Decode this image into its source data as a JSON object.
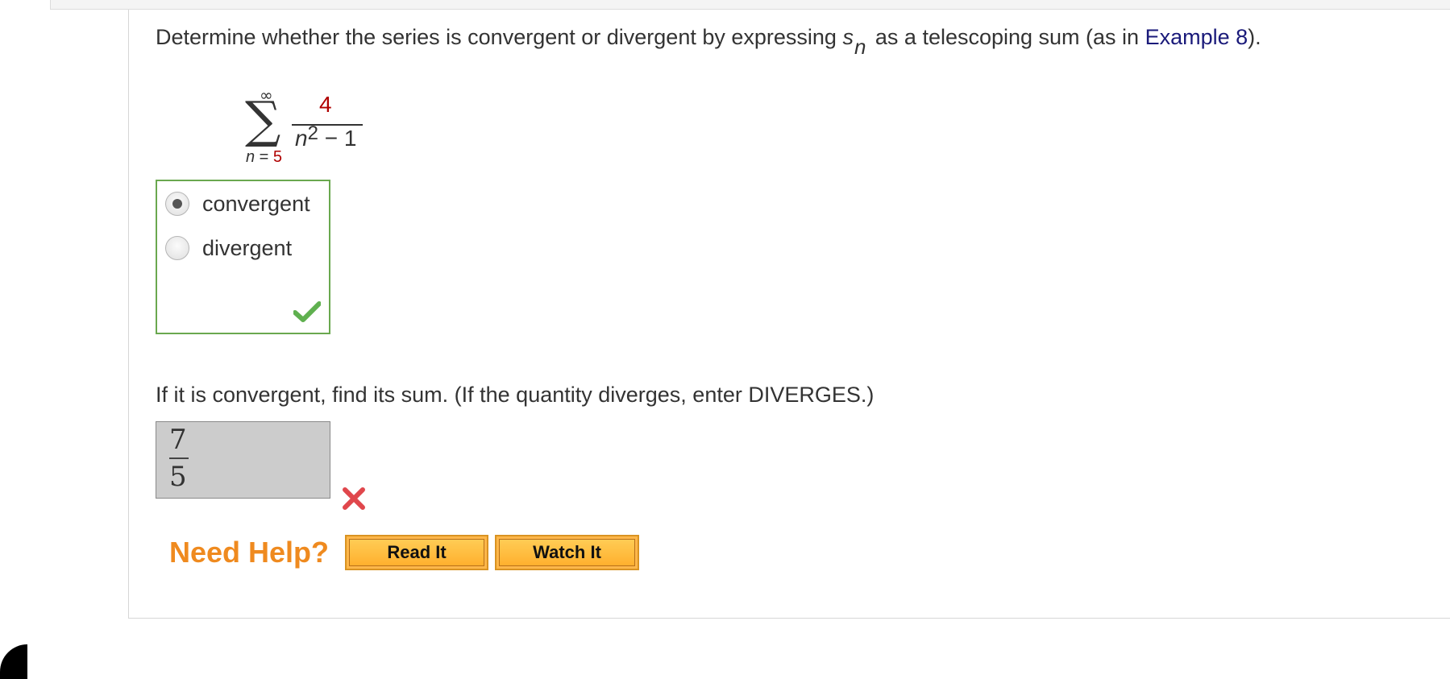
{
  "question": {
    "prefix": "Determine whether the series is convergent or divergent by expressing ",
    "s_var": "s",
    "n_sub": "n",
    "middle": " as a telescoping sum (as in ",
    "link_text": "Example 8",
    "suffix": ")."
  },
  "series": {
    "upper_limit": "∞",
    "sigma": "∑",
    "lower_var": "n",
    "lower_eq": " = ",
    "lower_value": "5",
    "numerator": "4",
    "den_var": "n",
    "den_exp": "2",
    "den_rest": " − 1"
  },
  "choices": {
    "options": [
      {
        "label": "convergent",
        "selected": true
      },
      {
        "label": "divergent",
        "selected": false
      }
    ],
    "status": "correct"
  },
  "sum_question": {
    "prompt": "If it is convergent, find its sum. (If the quantity diverges, enter DIVERGES.)",
    "answer_numerator": "7",
    "answer_denominator": "5",
    "status": "incorrect"
  },
  "help": {
    "label": "Need Help?",
    "read_button": "Read It",
    "watch_button": "Watch It"
  },
  "colors": {
    "correct_green": "#6aa84f",
    "incorrect_red": "#e0474c",
    "help_orange": "#ef8a1f",
    "link_blue": "#1a1a7a"
  }
}
